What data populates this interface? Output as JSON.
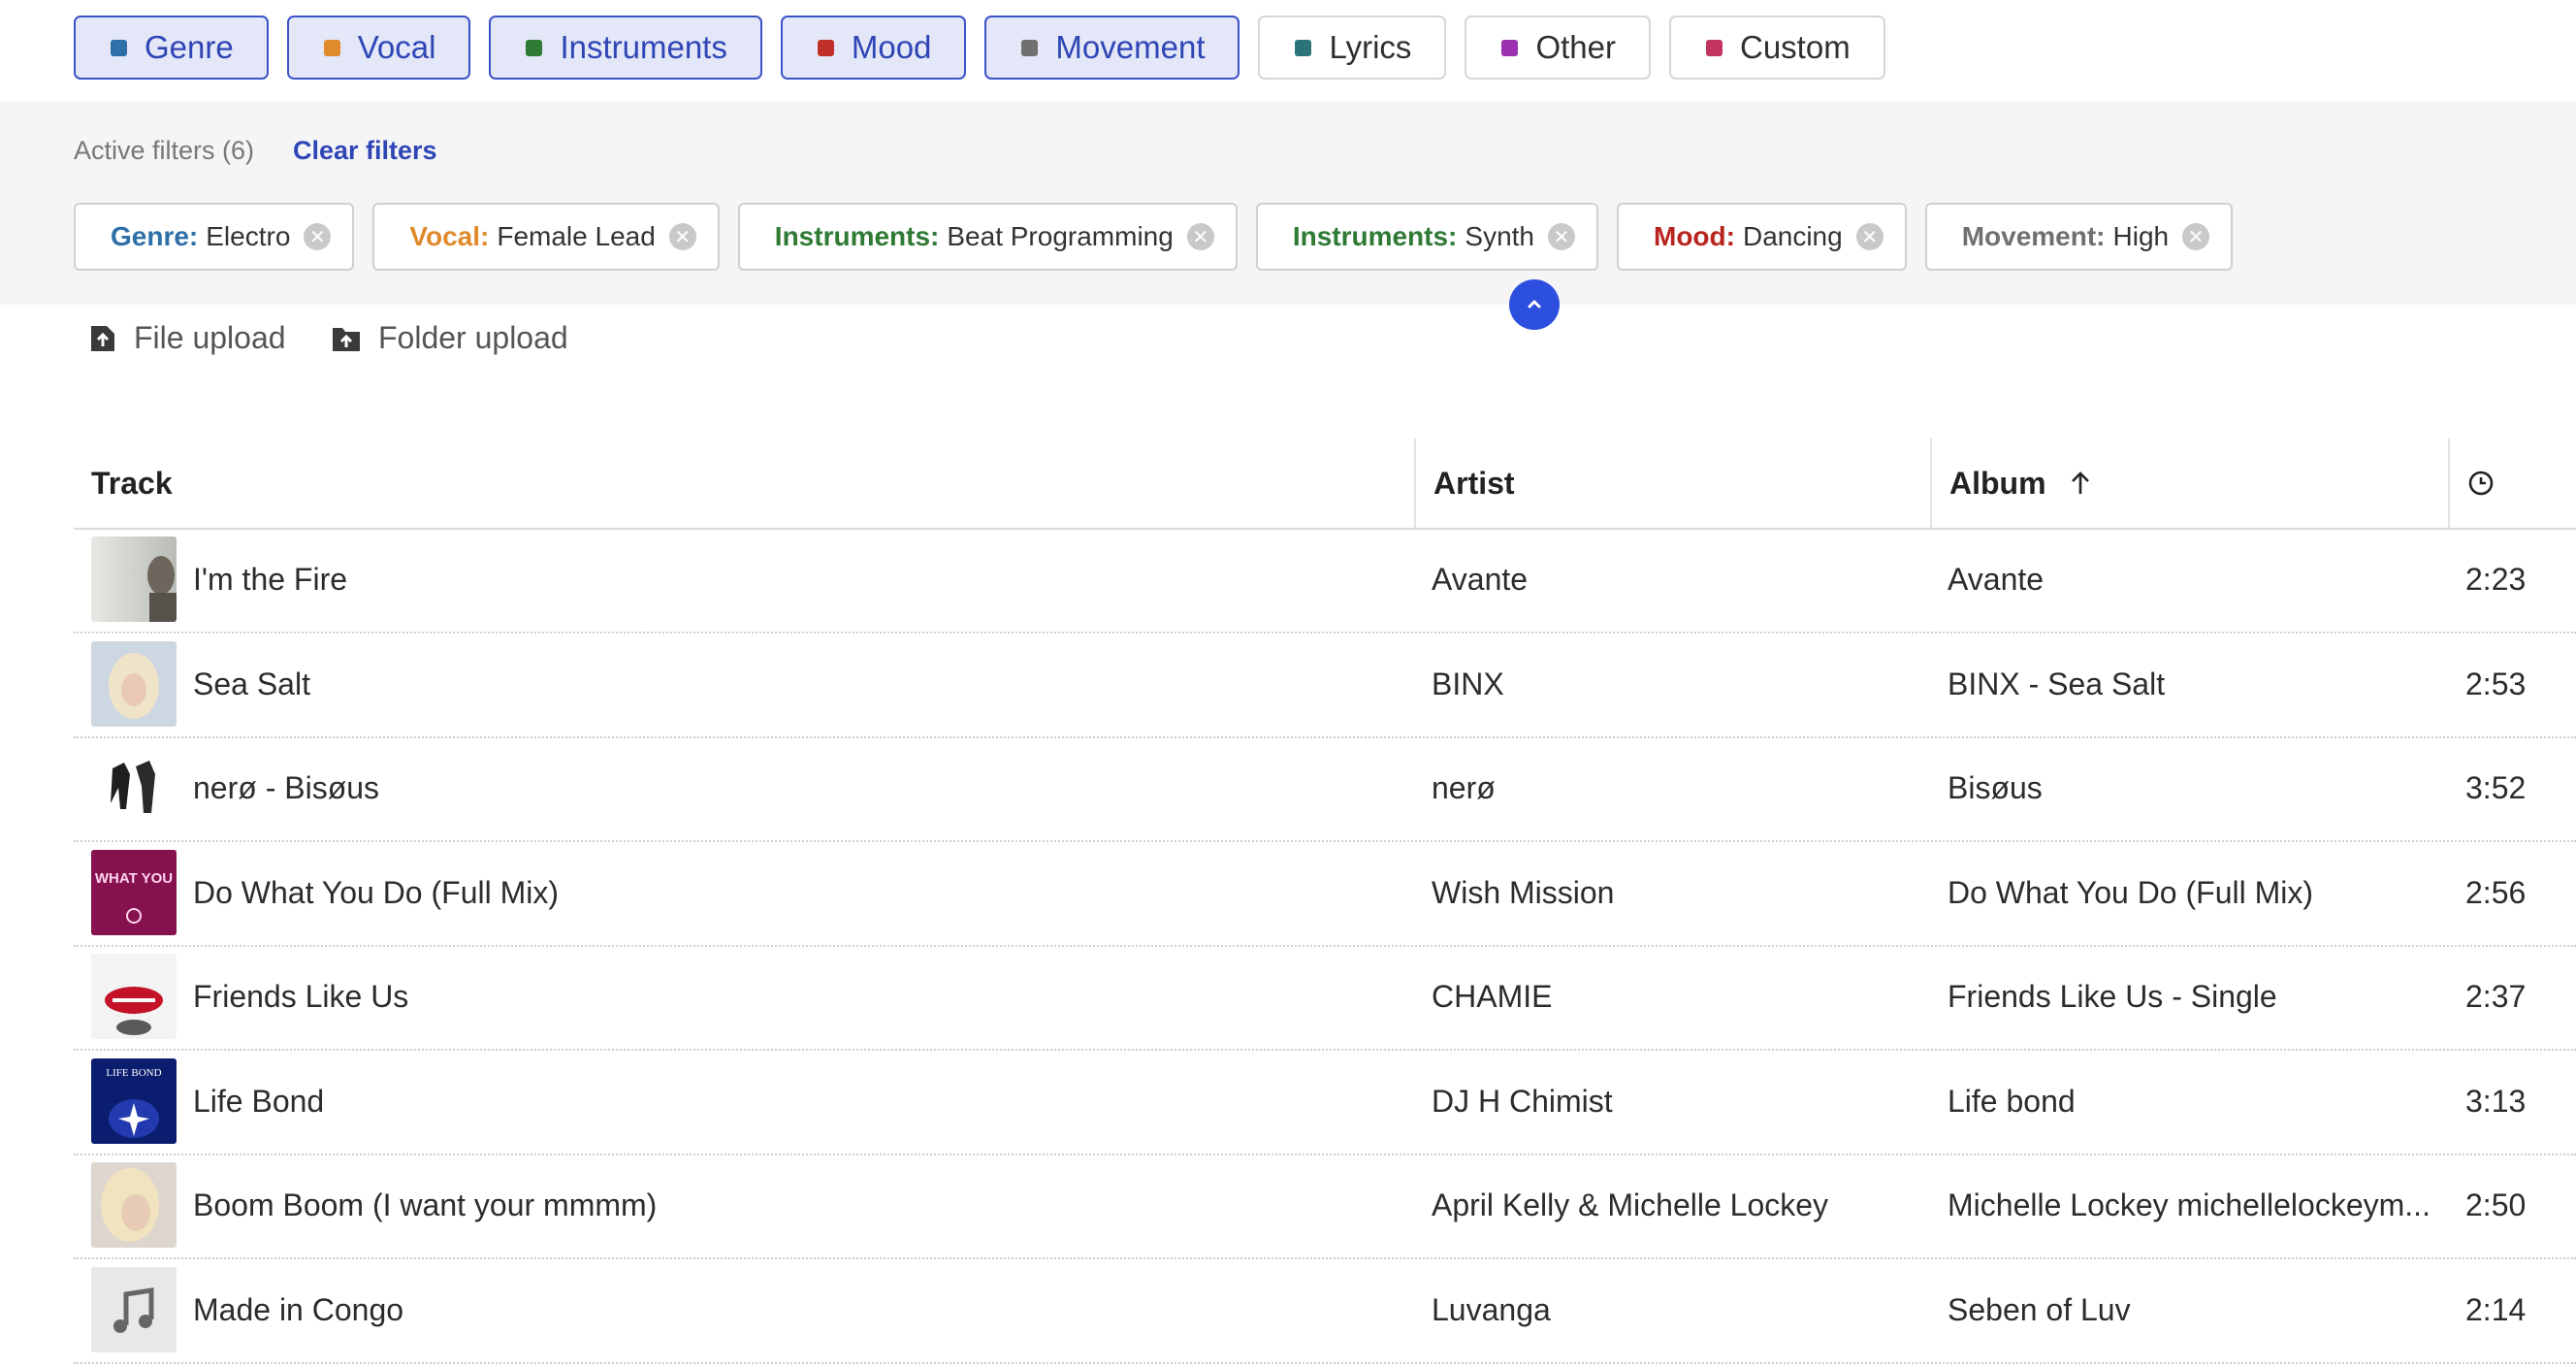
{
  "tabs": [
    {
      "label": "Genre",
      "color": "#2e6fa8",
      "active": true
    },
    {
      "label": "Vocal",
      "color": "#e08a2c",
      "active": true
    },
    {
      "label": "Instruments",
      "color": "#2f7a34",
      "active": true
    },
    {
      "label": "Mood",
      "color": "#c0302b",
      "active": true
    },
    {
      "label": "Movement",
      "color": "#707070",
      "active": true
    },
    {
      "label": "Lyrics",
      "color": "#2a7478",
      "active": false
    },
    {
      "label": "Other",
      "color": "#9a32b0",
      "active": false
    },
    {
      "label": "Custom",
      "color": "#c0345e",
      "active": false
    }
  ],
  "filters": {
    "active_label": "Active filters (6)",
    "clear_label": "Clear filters",
    "chips": [
      {
        "key": "Genre:",
        "value": "Electro",
        "color": "#2e6fa8"
      },
      {
        "key": "Vocal:",
        "value": "Female Lead",
        "color": "#e08a2c"
      },
      {
        "key": "Instruments:",
        "value": "Beat Programming",
        "color": "#2f7a34"
      },
      {
        "key": "Instruments:",
        "value": "Synth",
        "color": "#2f7a34"
      },
      {
        "key": "Mood:",
        "value": "Dancing",
        "color": "#b8251f"
      },
      {
        "key": "Movement:",
        "value": "High",
        "color": "#707070"
      }
    ]
  },
  "upload": {
    "file_label": "File upload",
    "folder_label": "Folder upload"
  },
  "table": {
    "headers": {
      "track": "Track",
      "artist": "Artist",
      "album": "Album",
      "duration_icon": "clock-icon"
    },
    "rows": [
      {
        "track": "I'm the Fire",
        "artist": "Avante",
        "album": "Avante",
        "duration": "2:23",
        "art": "gray-portrait"
      },
      {
        "track": "Sea Salt",
        "artist": "BINX",
        "album": "BINX - Sea Salt",
        "duration": "2:53",
        "art": "blonde"
      },
      {
        "track": "nerø - Bisøus",
        "artist": "nerø",
        "album": "Bisøus",
        "duration": "3:52",
        "art": "figures"
      },
      {
        "track": "Do What You Do (Full Mix)",
        "artist": "Wish Mission",
        "album": "Do What You Do (Full Mix)",
        "duration": "2:56",
        "art": "pink",
        "art_text": "DO WHAT YOU DO"
      },
      {
        "track": "Friends Like Us",
        "artist": "CHAMIE",
        "album": "Friends Like Us - Single",
        "duration": "2:37",
        "art": "lips"
      },
      {
        "track": "Life Bond",
        "artist": "DJ H Chimist",
        "album": "Life bond",
        "duration": "3:13",
        "art": "blue",
        "art_text": "LIFE BOND"
      },
      {
        "track": "Boom Boom (I want your mmmm)",
        "artist": "April Kelly & Michelle Lockey",
        "album": "Michelle Lockey michellelockeym...",
        "duration": "2:50",
        "art": "portrait"
      },
      {
        "track": "Made in Congo",
        "artist": "Luvanga",
        "album": "Seben of Luv",
        "duration": "2:14",
        "art": "placeholder"
      }
    ]
  }
}
